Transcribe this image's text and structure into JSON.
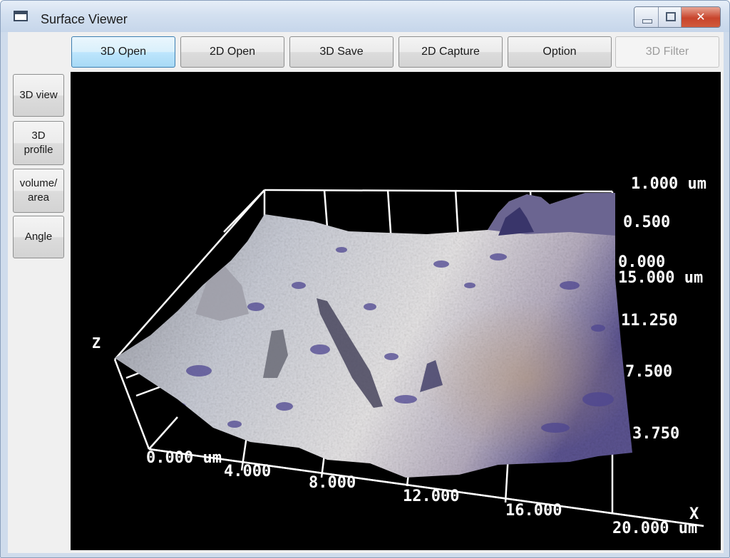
{
  "window": {
    "title": "Surface Viewer"
  },
  "toolbar": {
    "open_3d": "3D Open",
    "open_2d": "2D Open",
    "save_3d": "3D Save",
    "capture_2d": "2D Capture",
    "option": "Option",
    "filter_3d": "3D Filter"
  },
  "sidebar": {
    "view_3d": "3D view",
    "profile_3d_line1": "3D",
    "profile_3d_line2": "profile",
    "volume_line1": "volume/",
    "volume_line2": "area",
    "angle": "Angle"
  },
  "plot": {
    "z_axis_name": "Z",
    "x_axis_name": "X",
    "z_ticks": [
      "1.000 um",
      "0.500",
      "0.000"
    ],
    "y_ticks": [
      "15.000 um",
      "11.250",
      "7.500",
      "3.750"
    ],
    "x_ticks": [
      "0.000 um",
      "4.000",
      "8.000",
      "12.000",
      "16.000",
      "20.000 um"
    ]
  },
  "colors": {
    "viewport_bg": "#000000",
    "grid": "#ffffff",
    "surface_light": "#d8dbe2",
    "surface_purple": "#5a4f93"
  }
}
